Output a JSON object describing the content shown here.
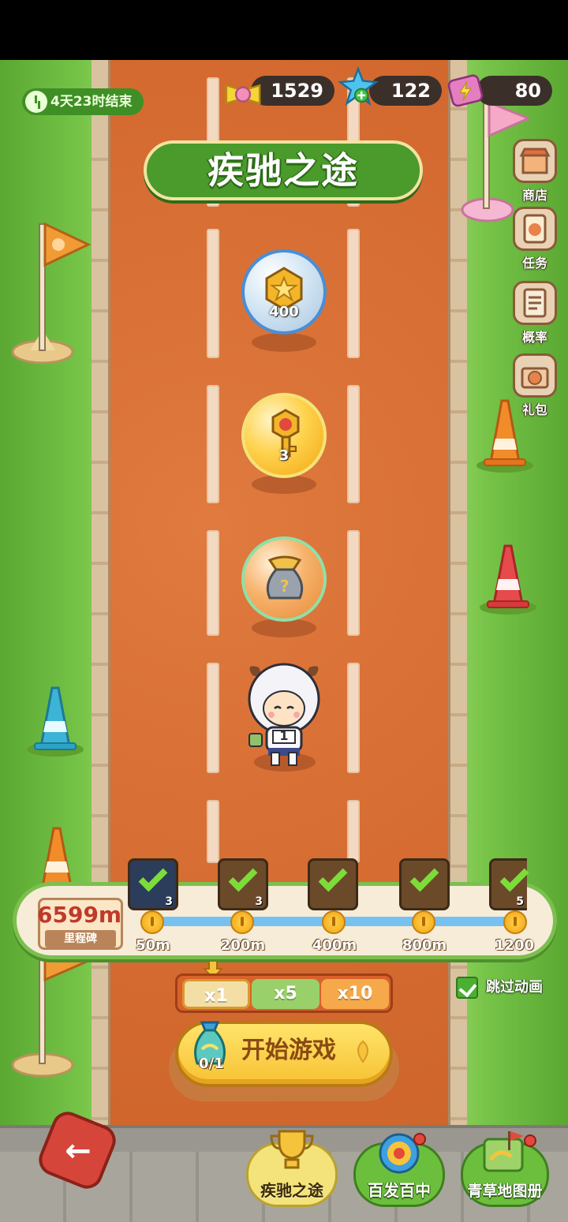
{
  "event": {
    "timer_text": "4天23时结束",
    "title": "疾驰之途"
  },
  "resources": {
    "tickets": "1529",
    "gems": "122",
    "energy": "80"
  },
  "side_menu": [
    {
      "label": "商店",
      "icon": "shop-icon"
    },
    {
      "label": "任务",
      "icon": "task-icon"
    },
    {
      "label": "概率",
      "icon": "probability-icon"
    },
    {
      "label": "礼包",
      "icon": "gift-pack-icon"
    }
  ],
  "track_rewards": [
    {
      "type": "coin",
      "count": "400"
    },
    {
      "type": "key",
      "count": "3"
    },
    {
      "type": "mystery-bag",
      "count": ""
    }
  ],
  "player": {
    "bib_number": "1"
  },
  "milestone": {
    "distance": "6599m",
    "label": "里程碑",
    "checkpoints": [
      {
        "distance": "50m",
        "reward_count": "3",
        "claimed": true
      },
      {
        "distance": "200m",
        "reward_count": "3",
        "claimed": true
      },
      {
        "distance": "400m",
        "reward_count": "",
        "claimed": true
      },
      {
        "distance": "800m",
        "reward_count": "",
        "claimed": true
      },
      {
        "distance": "1200",
        "reward_count": "5",
        "claimed": true
      }
    ]
  },
  "multipliers": {
    "options": [
      "x1",
      "x5",
      "x10"
    ],
    "selected": "x1"
  },
  "skip_animation": {
    "label": "跳过动画",
    "checked": true
  },
  "start": {
    "label": "开始游戏",
    "cost": "0/1"
  },
  "bottom_nav": [
    {
      "label": "疾驰之途",
      "active": true
    },
    {
      "label": "百发百中",
      "active": false
    },
    {
      "label": "青草地图册",
      "active": false
    }
  ],
  "colors": {
    "track": "#d46a30",
    "grass": "#6ab53c",
    "accent_yellow": "#f7c233",
    "distance_red": "#c0392b"
  }
}
